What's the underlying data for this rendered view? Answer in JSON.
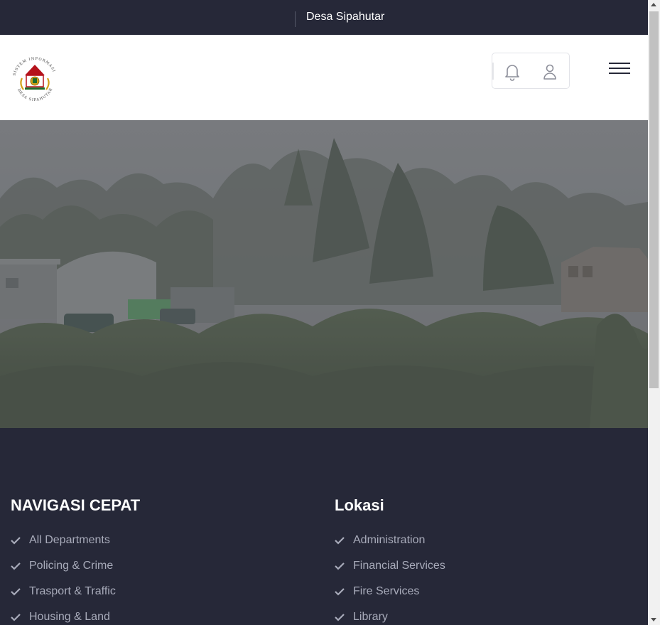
{
  "topbar": {
    "village_name": "Desa Sipahutar"
  },
  "header": {
    "logo_text_top": "SISTEM INFORMASI",
    "logo_text_bottom": "DESA SIPAHUTAR",
    "notification_icon": "bell-icon",
    "user_icon": "user-icon",
    "menu_icon": "hamburger-icon"
  },
  "footer": {
    "quick_nav": {
      "title": "NAVIGASI CEPAT",
      "items": [
        "All Departments",
        "Policing & Crime",
        "Trasport & Traffic",
        "Housing & Land"
      ]
    },
    "location": {
      "title": "Lokasi",
      "items": [
        "Administration",
        "Financial Services",
        "Fire Services",
        "Library"
      ]
    }
  },
  "colors": {
    "dark": "#262838",
    "link": "#a8abba",
    "white": "#ffffff"
  }
}
